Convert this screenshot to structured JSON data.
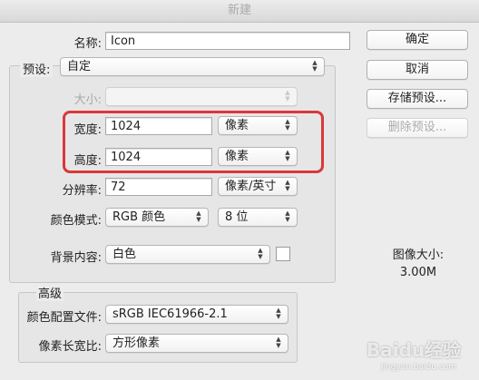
{
  "window": {
    "title": "新建"
  },
  "form": {
    "name_label": "名称:",
    "name_value": "Icon",
    "preset_label": "预设:",
    "preset_value": "自定",
    "size_label": "大小:",
    "size_value": "",
    "width_label": "宽度:",
    "width_value": "1024",
    "width_unit": "像素",
    "height_label": "高度:",
    "height_value": "1024",
    "height_unit": "像素",
    "resolution_label": "分辨率:",
    "resolution_value": "72",
    "resolution_unit": "像素/英寸",
    "color_mode_label": "颜色模式:",
    "color_mode_value": "RGB 颜色",
    "bit_depth_value": "8 位",
    "background_label": "背景内容:",
    "background_value": "白色"
  },
  "advanced": {
    "title": "高级",
    "color_profile_label": "颜色配置文件:",
    "color_profile_value": "sRGB IEC61966-2.1",
    "pixel_aspect_label": "像素长宽比:",
    "pixel_aspect_value": "方形像素"
  },
  "buttons": {
    "ok": "确定",
    "cancel": "取消",
    "save_preset": "存储预设...",
    "delete_preset": "删除预设..."
  },
  "image_size": {
    "label": "图像大小:",
    "value": "3.00M"
  },
  "watermark": {
    "logo": "Baidu经验",
    "url": "jingyan.baidu.com"
  },
  "colors": {
    "highlight": "#d9383a",
    "background_swatch": "#ffffff"
  }
}
